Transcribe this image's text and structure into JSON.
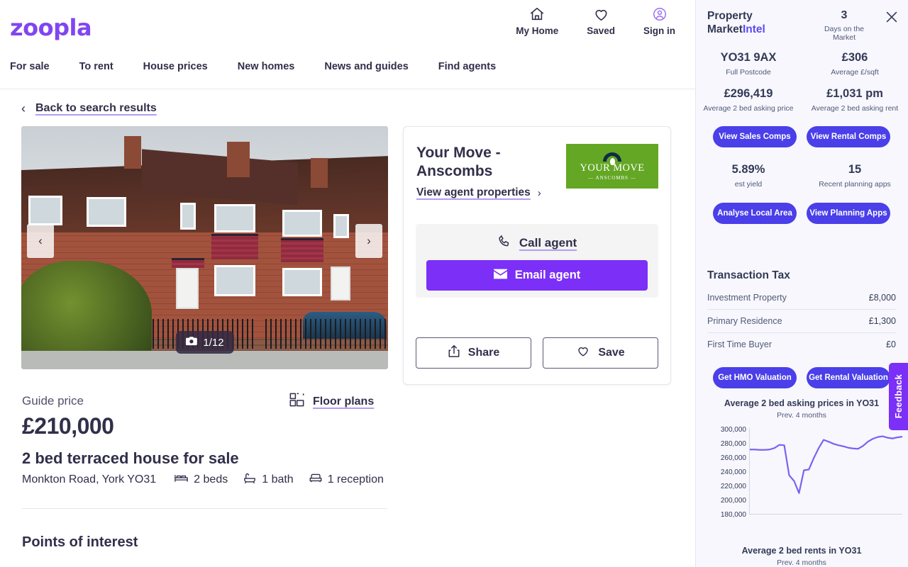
{
  "brand": {
    "logo": "zoopla"
  },
  "header": {
    "actions": [
      {
        "icon": "home-icon",
        "label": "My Home"
      },
      {
        "icon": "heart-icon",
        "label": "Saved"
      },
      {
        "icon": "user-circle-icon",
        "label": "Sign in"
      }
    ],
    "nav": [
      "For sale",
      "To rent",
      "House prices",
      "New homes",
      "News and guides",
      "Find agents"
    ]
  },
  "back": {
    "label": "Back to search results",
    "icon": "chevron-left-icon"
  },
  "gallery": {
    "counter": "1/12",
    "camera_icon": "camera-icon",
    "prev_icon": "chevron-left-icon",
    "next_icon": "chevron-right-icon"
  },
  "agent": {
    "name": "Your Move - Anscombs",
    "view_properties": "View agent properties",
    "view_properties_chevron": "›",
    "logo_line1": "YOUR MOVE",
    "logo_line2": "— ANSCOMBS —",
    "call_label": "Call agent",
    "email_label": "Email agent",
    "share_label": "Share",
    "save_label": "Save"
  },
  "listing": {
    "guide_price_label": "Guide price",
    "price": "£210,000",
    "floor_plans": "Floor plans",
    "title": "2 bed terraced house for sale",
    "address": "Monkton Road, York YO31",
    "beds": "2 beds",
    "baths": "1 bath",
    "receptions": "1 reception",
    "points_of_interest": "Points of interest"
  },
  "sidebar": {
    "title_line1": "Property",
    "title_line2_a": "Market",
    "title_line2_b": "Intel",
    "days_on_market": {
      "value": "3",
      "label": "Days on the Market"
    },
    "close_icon": "close-icon",
    "stats": [
      {
        "value": "YO31 9AX",
        "label": "Full Postcode"
      },
      {
        "value": "£306",
        "label": "Average £/sqft"
      },
      {
        "value": "£296,419",
        "label": "Average 2 bed asking price"
      },
      {
        "value": "£1,031 pm",
        "label": "Average 2 bed asking rent"
      }
    ],
    "comps_buttons": [
      "View Sales Comps",
      "View Rental Comps"
    ],
    "stats2": [
      {
        "value": "5.89%",
        "label": "est yield"
      },
      {
        "value": "15",
        "label": "Recent planning apps"
      }
    ],
    "area_buttons": [
      "Analyse Local Area",
      "View Planning Apps"
    ],
    "transaction_tax": {
      "title": "Transaction Tax",
      "rows": [
        {
          "label": "Investment Property",
          "amount": "£8,000"
        },
        {
          "label": "Primary Residence",
          "amount": "£1,300"
        },
        {
          "label": "First Time Buyer",
          "amount": "£0"
        }
      ]
    },
    "valuation_buttons": [
      "Get HMO Valuation",
      "Get Rental Valuation"
    ],
    "feedback": "Feedback",
    "accent_color": "#5b4bf0",
    "pill_color": "#4a3fe8",
    "background": "#f7f7fd"
  },
  "chart_data": [
    {
      "type": "line",
      "title": "Average 2 bed asking prices in YO31",
      "subtitle": "Prev. 4 months",
      "xlabel": "",
      "ylabel": "",
      "ylim": [
        180000,
        300000
      ],
      "yticks": [
        300000,
        280000,
        260000,
        240000,
        220000,
        200000,
        180000
      ],
      "ytick_labels": [
        "300,000",
        "280,000",
        "260,000",
        "240,000",
        "220,000",
        "200,000",
        "180,000"
      ],
      "grid": false,
      "legend": "none",
      "line_color": "#7b62f0",
      "series": [
        {
          "name": "Average 2 bed asking price",
          "values": [
            270000,
            270000,
            269500,
            269500,
            270000,
            272000,
            276500,
            276000,
            234000,
            226000,
            209000,
            241000,
            242000,
            258000,
            272000,
            283500,
            281000,
            278000,
            276000,
            274500,
            272500,
            271500,
            271000,
            275000,
            281000,
            285000,
            287500,
            288500,
            286500,
            285500,
            287000,
            288000
          ]
        }
      ]
    },
    {
      "type": "line",
      "title": "Average 2 bed rents in YO31",
      "subtitle": "Prev. 4 months",
      "xlabel": "",
      "ylabel": "",
      "grid": false,
      "legend": "none",
      "line_color": "#7b62f0",
      "series": [
        {
          "name": "Average 2 bed rent",
          "values": []
        }
      ]
    }
  ]
}
